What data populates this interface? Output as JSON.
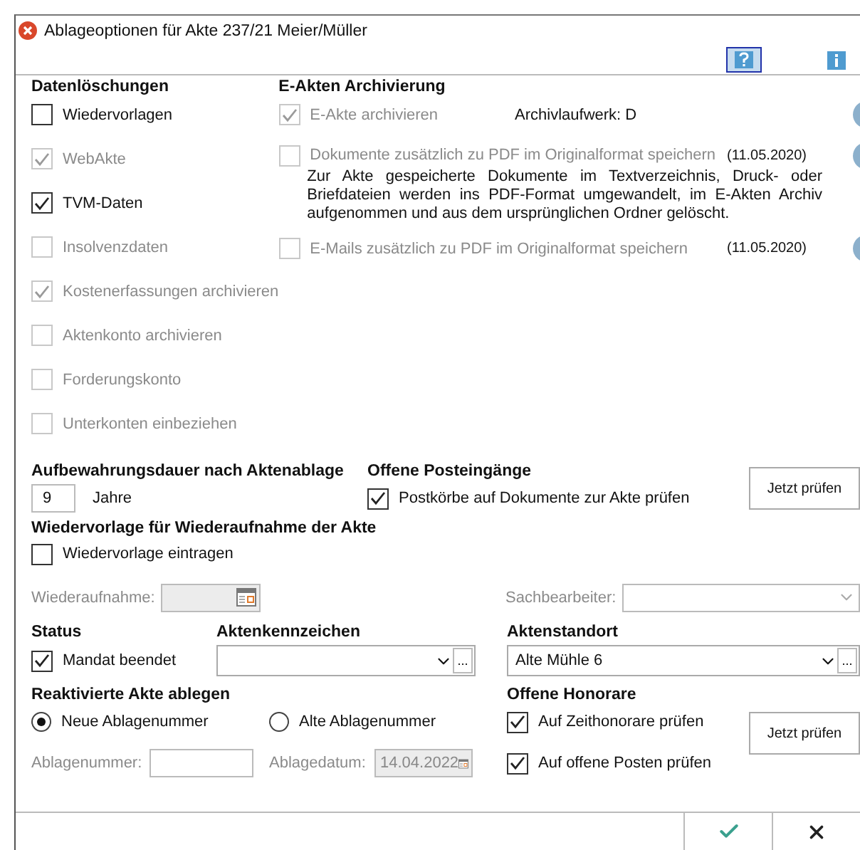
{
  "window": {
    "title": "Ablageoptionen für Akte 237/21 Meier/Müller"
  },
  "deletion": {
    "heading": "Datenlöschungen",
    "options": [
      {
        "label": "Wiedervorlagen",
        "checked": false,
        "disabled": false
      },
      {
        "label": "WebAkte",
        "checked": true,
        "disabled": true
      },
      {
        "label": "TVM-Daten",
        "checked": true,
        "disabled": false
      },
      {
        "label": "Insolvenzdaten",
        "checked": false,
        "disabled": true
      },
      {
        "label": "Kostenerfassungen archivieren",
        "checked": true,
        "disabled": true
      },
      {
        "label": "Aktenkonto archivieren",
        "checked": false,
        "disabled": true
      },
      {
        "label": "Forderungskonto",
        "checked": false,
        "disabled": true
      },
      {
        "label": "Unterkonten einbeziehen",
        "checked": false,
        "disabled": true
      }
    ]
  },
  "archiving": {
    "heading": "E-Akten Archivierung",
    "options": [
      {
        "label": "E-Akte archivieren",
        "checked": true,
        "disabled": true,
        "note": "Archivlaufwerk: D"
      },
      {
        "label": "Dokumente zusätzlich zu PDF im Originalformat speichern",
        "checked": false,
        "disabled": true,
        "date": "(11.05.2020)",
        "description": "Zur Akte gespeicherte Dokumente im Textverzeichnis, Druck- oder Briefdateien werden ins PDF-Format umgewandelt, im E-Akten Archiv aufgenommen und aus dem ursprünglichen Ordner gelöscht."
      },
      {
        "label": "E-Mails zusätzlich zu PDF im Originalformat speichern",
        "checked": false,
        "disabled": true,
        "date": "(11.05.2020)"
      }
    ]
  },
  "retention": {
    "heading": "Aufbewahrungsdauer nach Aktenablage",
    "value": "9",
    "unit": "Jahre"
  },
  "inbox": {
    "heading": "Offene Posteingänge",
    "option": {
      "label": "Postkörbe auf Dokumente zur Akte prüfen",
      "checked": true,
      "disabled": false
    },
    "button": "Jetzt prüfen"
  },
  "resubmission": {
    "heading": "Wiedervorlage für Wiederaufnahme der Akte",
    "option": {
      "label": "Wiedervorlage eintragen",
      "checked": false,
      "disabled": false
    },
    "date_label": "Wiederaufnahme:",
    "clerk_label": "Sachbearbeiter:"
  },
  "status": {
    "heading": "Status",
    "option": {
      "label": "Mandat beendet",
      "checked": true,
      "disabled": false
    }
  },
  "file_reference": {
    "heading": "Aktenkennzeichen"
  },
  "location": {
    "heading": "Aktenstandort",
    "value": "Alte Mühle 6"
  },
  "reactivated": {
    "heading": "Reaktivierte Akte ablegen",
    "radios": [
      {
        "label": "Neue Ablagenummer",
        "selected": true
      },
      {
        "label": "Alte Ablagenummer",
        "selected": false
      }
    ],
    "number_label": "Ablagenummer:",
    "date_label": "Ablagedatum:",
    "date_value": "14.04.2022"
  },
  "fees": {
    "heading": "Offene Honorare",
    "options": [
      {
        "label": "Auf Zeithonorare prüfen",
        "checked": true,
        "disabled": false
      },
      {
        "label": "Auf offene Posten prüfen",
        "checked": true,
        "disabled": false
      }
    ],
    "button": "Jetzt prüfen"
  },
  "browse_label": "..."
}
